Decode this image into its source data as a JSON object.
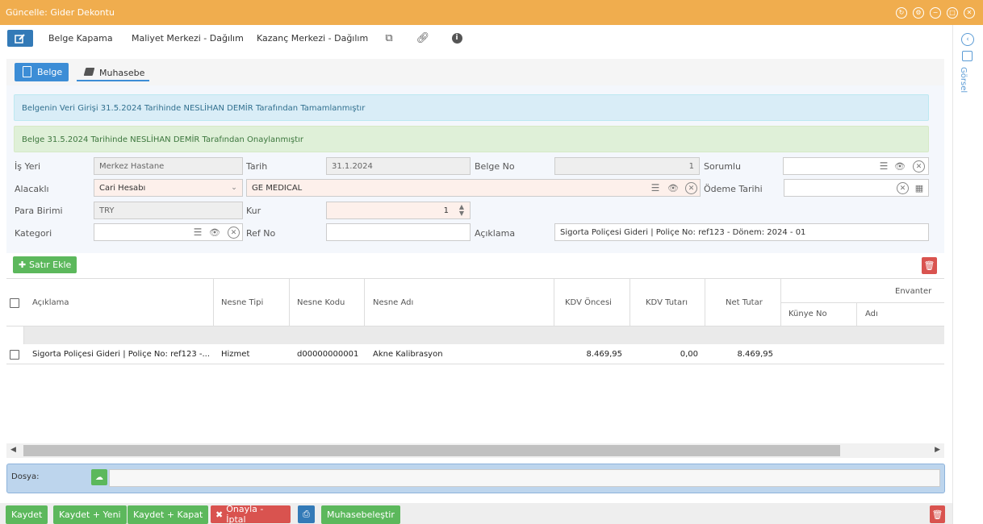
{
  "title": "Güncelle: Gider Dekontu",
  "toolbar": {
    "belge_kapama": "Belge Kapama",
    "maliyet": "Maliyet Merkezi - Dağılım",
    "kazanc": "Kazanç Merkezi - Dağılım"
  },
  "sidebar": {
    "gorsel": "Görsel"
  },
  "tabs": {
    "belge": "Belge",
    "muhasebe": "Muhasebe"
  },
  "alerts": {
    "info": "Belgenin Veri Girişi 31.5.2024 Tarihinde NESLİHAN DEMİR Tarafından Tamamlanmıştır",
    "success": "Belge 31.5.2024 Tarihinde NESLİHAN DEMİR Tarafından Onaylanmıştır"
  },
  "form": {
    "is_yeri_label": "İş Yeri",
    "is_yeri_value": "Merkez Hastane",
    "tarih_label": "Tarih",
    "tarih_value": "31.1.2024",
    "belge_no_label": "Belge No",
    "belge_no_value": "1",
    "sorumlu_label": "Sorumlu",
    "sorumlu_value": "",
    "alacakli_label": "Alacaklı",
    "alacakli_type": "Cari Hesabı",
    "alacakli_value": "GE MEDICAL",
    "odeme_tarihi_label": "Ödeme Tarihi",
    "odeme_tarihi_value": "",
    "para_birimi_label": "Para Birimi",
    "para_birimi_value": "TRY",
    "kur_label": "Kur",
    "kur_value": "1",
    "kategori_label": "Kategori",
    "kategori_value": "",
    "ref_no_label": "Ref No",
    "ref_no_value": "",
    "aciklama_label": "Açıklama",
    "aciklama_value": "Sigorta Poliçesi Gideri | Poliçe No: ref123 - Dönem: 2024 - 01"
  },
  "grid": {
    "add_row": "Satır Ekle",
    "columns": {
      "aciklama": "Açıklama",
      "nesne_tipi": "Nesne Tipi",
      "nesne_kodu": "Nesne Kodu",
      "nesne_adi": "Nesne Adı",
      "kdv_oncesi": "KDV Öncesi",
      "kdv_tutari": "KDV Tutarı",
      "net_tutar": "Net Tutar",
      "envanter": "Envanter",
      "kunye_no": "Künye No",
      "adi": "Adı"
    },
    "rows": [
      {
        "aciklama": "Sigorta Poliçesi Gideri | Poliçe No: ref123 -...",
        "nesne_tipi": "Hizmet",
        "nesne_kodu": "d00000000001",
        "nesne_adi": "Akne Kalibrasyon",
        "kdv_oncesi": "8.469,95",
        "kdv_tutari": "0,00",
        "net_tutar": "8.469,95"
      }
    ]
  },
  "file": {
    "label": "Dosya:"
  },
  "footer": {
    "kaydet": "Kaydet",
    "kaydet_yeni": "Kaydet + Yeni",
    "kaydet_kapat": "Kaydet + Kapat",
    "onay_iptal": "Onayla - İptal",
    "muhasebelestir": "Muhasebeleştir"
  },
  "colors": {
    "title_bg": "#f0ad4e",
    "primary": "#337ab7",
    "green": "#5cb85c",
    "red": "#d9534f"
  }
}
